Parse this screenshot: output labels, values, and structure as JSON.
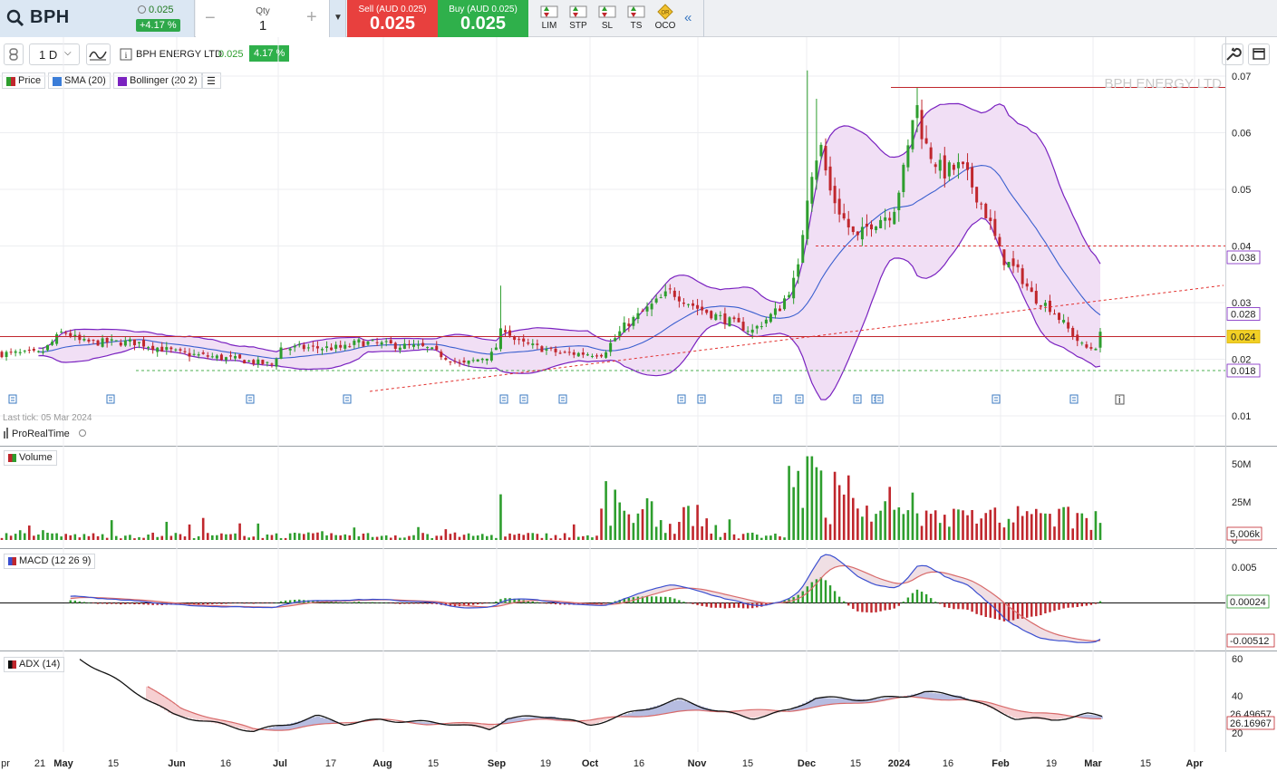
{
  "header": {
    "symbol": "BPH",
    "last_price": "0.025",
    "change_pct": "+4.17 %",
    "qty_label": "Qty",
    "qty_value": "1",
    "sell_label": "Sell (AUD 0.025)",
    "sell_value": "0.025",
    "buy_label": "Buy (AUD 0.025)",
    "buy_value": "0.025",
    "order_types": [
      "LIM",
      "STP",
      "SL",
      "TS",
      "OCO"
    ]
  },
  "toolbar": {
    "timeframe": "1 D",
    "instrument_name": "BPH ENERGY LTD",
    "instrument_price": "0.025",
    "instrument_change": "4.17 %"
  },
  "legend": {
    "price": "Price",
    "sma": "SMA (20)",
    "bollinger": "Bollinger (20 2)"
  },
  "watermark": "BPH ENERGY LTD",
  "last_tick": "Last tick: 05 Mar 2024",
  "provider": "ProRealTime",
  "panels": {
    "volume_label": "Volume",
    "macd_label": "MACD (12 26 9)",
    "adx_label": "ADX (14)"
  },
  "price_axis": {
    "ticks": [
      "0.07",
      "0.06",
      "0.05",
      "0.04",
      "0.03",
      "0.02",
      "0.01"
    ],
    "badges": {
      "upper": "0.038",
      "sma": "0.028",
      "last": "0.024",
      "lower": "0.018"
    }
  },
  "volume_axis": {
    "ticks": [
      "50M",
      "25M",
      "0"
    ],
    "badge": "5,006k"
  },
  "macd_axis": {
    "ticks": [
      "0.005"
    ],
    "badge_signal": "0.00024",
    "badge_macd": "-0.00512"
  },
  "adx_axis": {
    "ticks": [
      "60",
      "40",
      "20"
    ],
    "badge_upper": "26.49657",
    "badge_lower": "26.16967"
  },
  "time_axis": [
    "pr",
    "21",
    "May",
    "15",
    "Jun",
    "16",
    "Jul",
    "17",
    "Aug",
    "15",
    "Sep",
    "19",
    "Oct",
    "16",
    "Nov",
    "15",
    "Dec",
    "15",
    "2024",
    "16",
    "Feb",
    "19",
    "Mar",
    "15",
    "Apr"
  ],
  "colors": {
    "up": "#2e9e2e",
    "down": "#c0272d",
    "bollinger": "#7a22c0",
    "sma": "#3a5fcf",
    "band_fill": "#f0dcf4",
    "last_line": "#c0272d"
  },
  "chart_data": {
    "type": "candlestick",
    "title": "BPH ENERGY LTD",
    "timeframe": "1 D",
    "ylim": [
      0.005,
      0.072
    ],
    "levels": {
      "resistance": 0.068,
      "dashed_resistance": 0.04,
      "last_price_line": 0.024,
      "support_dashed": 0.018
    },
    "monthly_ohlc": [
      {
        "month": "May 2023",
        "close": 0.024
      },
      {
        "month": "Jun 2023",
        "close": 0.022
      },
      {
        "month": "Jul 2023",
        "close": 0.023
      },
      {
        "month": "Aug 2023",
        "close": 0.021
      },
      {
        "month": "Sep 2023",
        "close": 0.022
      },
      {
        "month": "Oct 2023",
        "close": 0.028
      },
      {
        "month": "Nov 2023",
        "close": 0.03
      },
      {
        "month": "Dec 2023",
        "close": 0.045
      },
      {
        "month": "Jan 2024",
        "close": 0.05
      },
      {
        "month": "Feb 2024",
        "close": 0.03
      },
      {
        "month": "Mar 2024",
        "close": 0.025
      }
    ]
  }
}
